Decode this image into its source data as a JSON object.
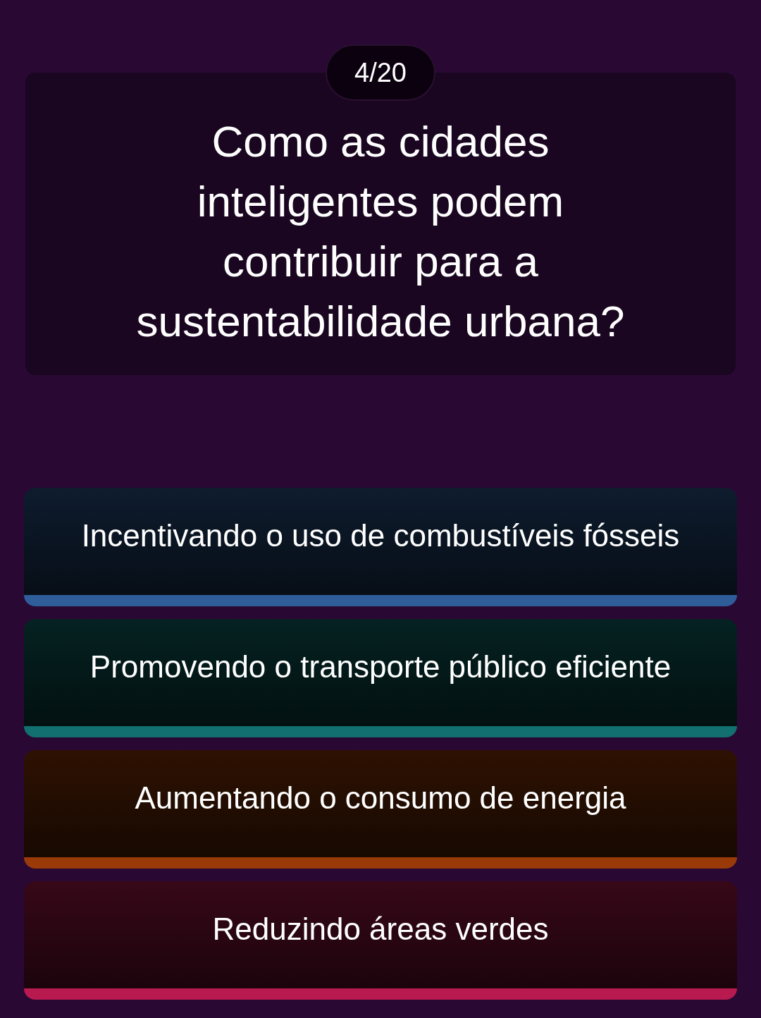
{
  "progress": "4/20",
  "question": "Como as cidades inteligentes podem contribuir para a sustentabilidade urbana?",
  "answers": [
    {
      "label": "Incentivando o uso de combustíveis fósseis",
      "color": "#2f5d9a"
    },
    {
      "label": "Promovendo o transporte público eficiente",
      "color": "#127070"
    },
    {
      "label": "Aumentando o consumo de energia",
      "color": "#9a3a08"
    },
    {
      "label": "Reduzindo áreas verdes",
      "color": "#b81a50"
    }
  ]
}
